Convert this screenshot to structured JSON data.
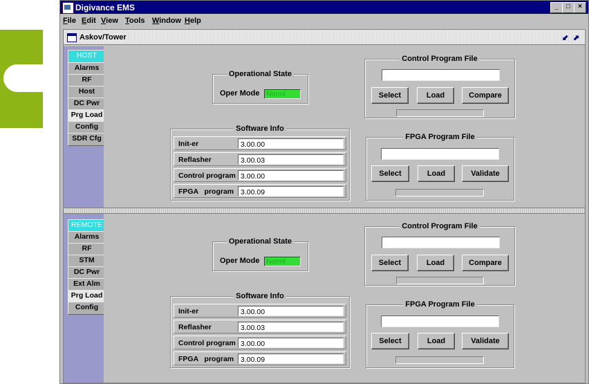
{
  "window": {
    "title": "Digivance EMS",
    "controls": [
      "_",
      "□",
      "×"
    ]
  },
  "menu": [
    "File",
    "Edit",
    "View",
    "Tools",
    "Window",
    "Help"
  ],
  "internal_frame": {
    "title": "Askov/Tower"
  },
  "host": {
    "header": "HOST",
    "tabs": [
      "Alarms",
      "RF",
      "Host",
      "DC Pwr",
      "Prg Load",
      "Config",
      "SDR Cfg"
    ],
    "selected_tab": "Prg Load",
    "operational_state": {
      "title": "Operational State",
      "label": "Oper Mode",
      "value": "Norml"
    },
    "software_info": {
      "title": "Software Info",
      "rows": [
        {
          "label": "Init-er",
          "value": "3.00.00"
        },
        {
          "label": "Reflasher",
          "value": "3.00.03"
        },
        {
          "label": "Control program",
          "value": "3.00.00"
        },
        {
          "label": "FPGA   program",
          "value": "3.00.09"
        }
      ]
    },
    "control_program_file": {
      "title": "Control Program File",
      "path": "",
      "buttons": [
        "Select",
        "Load",
        "Compare"
      ]
    },
    "fpga_program_file": {
      "title": "FPGA Program File",
      "path": "",
      "buttons": [
        "Select",
        "Load",
        "Validate"
      ]
    }
  },
  "remote": {
    "header": "REMOTE",
    "tabs": [
      "Alarms",
      "RF",
      "STM",
      "DC Pwr",
      "Ext Alm",
      "Prg Load",
      "Config"
    ],
    "selected_tab": "Prg Load",
    "operational_state": {
      "title": "Operational State",
      "label": "Oper Mode",
      "value": "Norml"
    },
    "software_info": {
      "title": "Software Info",
      "rows": [
        {
          "label": "Init-er",
          "value": "3.00.00"
        },
        {
          "label": "Reflasher",
          "value": "3.00.03"
        },
        {
          "label": "Control program",
          "value": "3.00.00"
        },
        {
          "label": "FPGA   program",
          "value": "3.00.09"
        }
      ]
    },
    "control_program_file": {
      "title": "Control Program File",
      "path": "",
      "buttons": [
        "Select",
        "Load",
        "Compare"
      ]
    },
    "fpga_program_file": {
      "title": "FPGA Program File",
      "path": "",
      "buttons": [
        "Select",
        "Load",
        "Validate"
      ]
    }
  },
  "colors": {
    "titlebar": "#000080",
    "side_panel": "#9999cc",
    "led": "#33dd33",
    "header_tab": "#33dddd",
    "logo": "#8cb515"
  }
}
